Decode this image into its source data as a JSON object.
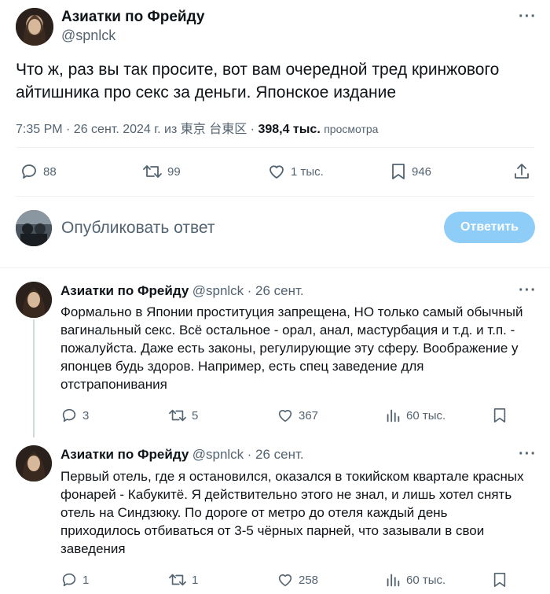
{
  "main_tweet": {
    "author_name": "Азиатки по Фрейду",
    "author_handle": "@spnlck",
    "text_line1": "Что ж, раз вы так просите, вот вам очередной тред кринжового",
    "text_line2": "айтишника про секс за деньги. Японское издание",
    "meta_time": "7:35 PM · 26 сент. 2024 г. из 東京 台東区 · ",
    "views_count": "398,4 тыс.",
    "views_label": "просмотра",
    "replies": "88",
    "retweets": "99",
    "likes": "1 тыс.",
    "bookmarks": "946"
  },
  "compose": {
    "placeholder": "Опубликовать ответ",
    "button_label": "Ответить"
  },
  "replies": [
    {
      "author_name": "Азиатки по Фрейду",
      "author_handle": "@spnlck",
      "date": "· 26 сент.",
      "lines": [
        "Формально в Японии проституция запрещена, НО только самый обычный",
        "вагинальный секс. Всё остальное - орал, анал, мастурбация и т.д. и т.п. -",
        "пожалуйста. Даже есть законы, регулирующие эту сферу. Воображение у",
        "японцев будь здоров. Например, есть спец заведение для",
        "отстрапонивания"
      ],
      "replies": "3",
      "retweets": "5",
      "likes": "367",
      "views": "60 тыс."
    },
    {
      "author_name": "Азиатки по Фрейду",
      "author_handle": "@spnlck",
      "date": "· 26 сент.",
      "lines": [
        "Первый отель, где я остановился, оказался в токийском квартале красных",
        "фонарей - Кабукитё. Я действительно этого не знал, и лишь хотел снять",
        "отель на Синдзюку. По дороге от метро до отеля каждый день",
        "приходилось отбиваться от 3-5 чёрных парней, что зазывали в свои",
        "заведения"
      ],
      "replies": "1",
      "retweets": "1",
      "likes": "258",
      "views": "60 тыс."
    }
  ],
  "colors": {
    "accent": "#1d9bf0",
    "accent_disabled": "#8ecdf8",
    "muted": "#536471",
    "divider": "#eff3f4"
  }
}
